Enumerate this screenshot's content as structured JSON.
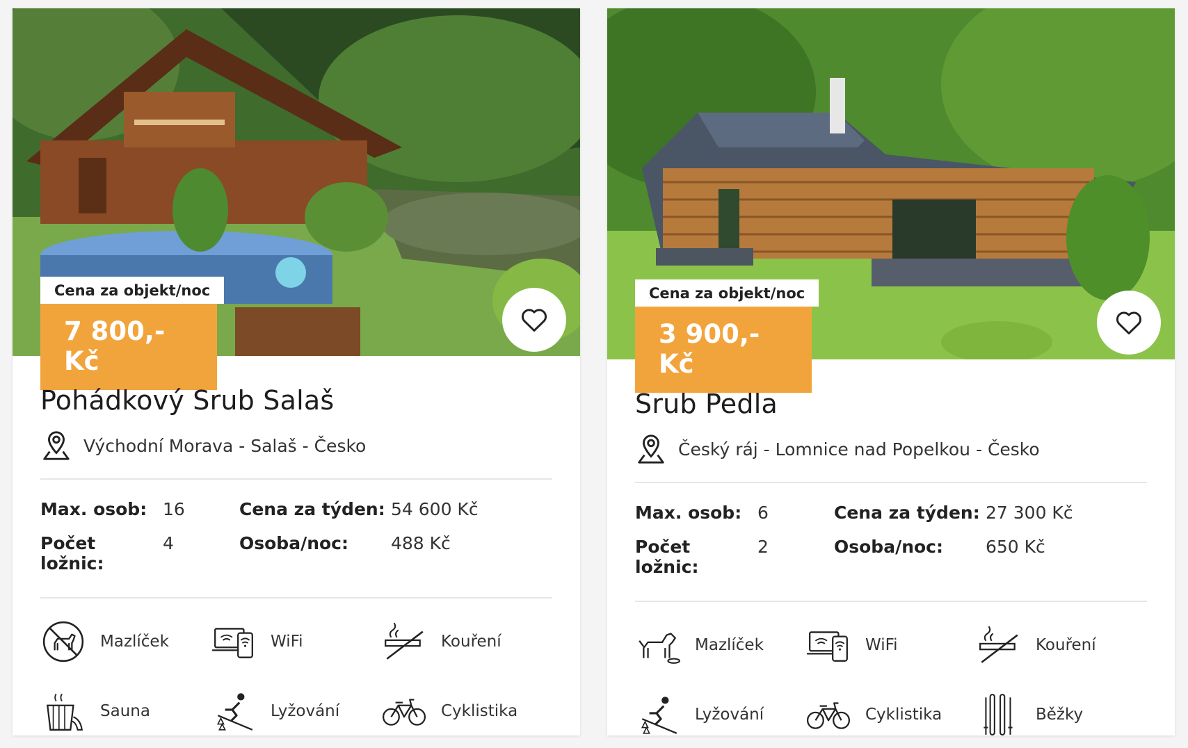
{
  "cards": [
    {
      "price_label": "Cena za objekt/noc",
      "price": "7 800,- Kč",
      "title": "Pohádkový Srub Salaš",
      "location": "Východní Morava - Salaš - Česko",
      "stats": {
        "max_label": "Max. osob:",
        "max_value": "16",
        "week_label": "Cena za týden:",
        "week_value": "54 600 Kč",
        "bed_label": "Počet ložnic:",
        "bed_value": "4",
        "night_label": "Osoba/noc:",
        "night_value": "488 Kč"
      },
      "features": [
        {
          "label": "Mazlíček",
          "icon": "no-pet-icon"
        },
        {
          "label": "WiFi",
          "icon": "wifi-devices-icon"
        },
        {
          "label": "Kouření",
          "icon": "no-smoking-icon"
        },
        {
          "label": "Sauna",
          "icon": "sauna-bucket-icon"
        },
        {
          "label": "Lyžování",
          "icon": "skiing-icon"
        },
        {
          "label": "Cyklistika",
          "icon": "bicycle-icon"
        }
      ]
    },
    {
      "price_label": "Cena za objekt/noc",
      "price": "3 900,- Kč",
      "title": "Srub Pedla",
      "location": "Český ráj - Lomnice nad Popelkou - Česko",
      "stats": {
        "max_label": "Max. osob:",
        "max_value": "6",
        "week_label": "Cena za týden:",
        "week_value": "27 300 Kč",
        "bed_label": "Počet ložnic:",
        "bed_value": "2",
        "night_label": "Osoba/noc:",
        "night_value": "650 Kč"
      },
      "features": [
        {
          "label": "Mazlíček",
          "icon": "pet-icon"
        },
        {
          "label": "WiFi",
          "icon": "wifi-devices-icon"
        },
        {
          "label": "Kouření",
          "icon": "no-smoking-icon"
        },
        {
          "label": "Lyžování",
          "icon": "skiing-icon"
        },
        {
          "label": "Cyklistika",
          "icon": "bicycle-icon"
        },
        {
          "label": "Běžky",
          "icon": "cross-country-ski-icon"
        }
      ]
    }
  ],
  "colors": {
    "accent": "#f2a43c",
    "card": "#ffffff",
    "background": "#f4f4f4"
  }
}
